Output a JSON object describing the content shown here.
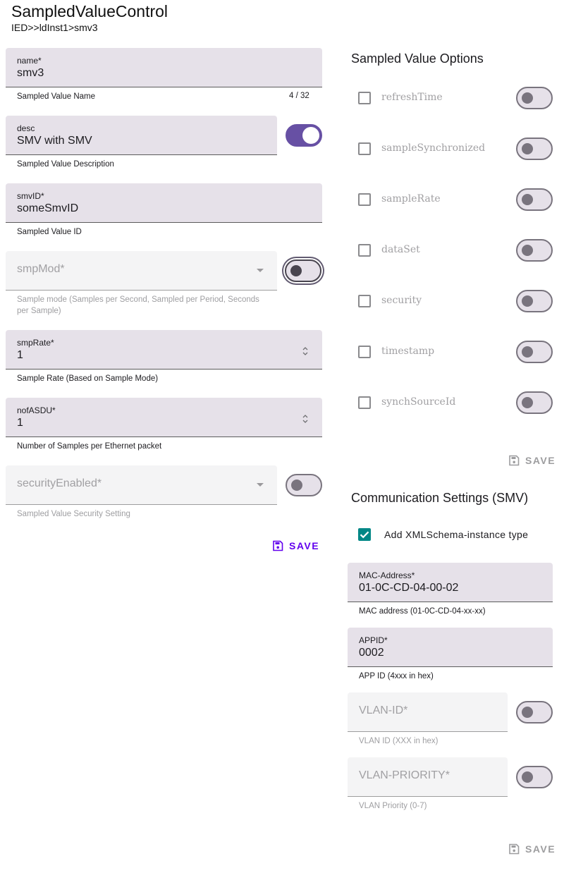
{
  "header": {
    "title": "SampledValueControl",
    "breadcrumb": "IED>>ldInst1>smv3"
  },
  "left_form": {
    "name": {
      "label": "name*",
      "value": "smv3",
      "helper": "Sampled Value Name",
      "counter": "4 / 32"
    },
    "desc": {
      "label": "desc",
      "value": "SMV with SMV",
      "helper": "Sampled Value Description",
      "switch_on": true
    },
    "smvID": {
      "label": "smvID*",
      "value": "someSmvID",
      "helper": "Sampled Value ID"
    },
    "smpMod": {
      "placeholder": "smpMod*",
      "helper": "Sample mode (Samples per Second, Sampled per Period, Seconds per Sample)",
      "switch_on": false
    },
    "smpRate": {
      "label": "smpRate*",
      "value": "1",
      "helper": "Sample Rate (Based on Sample Mode)"
    },
    "nofASDU": {
      "label": "nofASDU*",
      "value": "1",
      "helper": "Number of Samples per Ethernet packet"
    },
    "securityEnabled": {
      "placeholder": "securityEnabled*",
      "helper": "Sampled Value Security Setting",
      "switch_on": false
    },
    "save_label": "SAVE"
  },
  "options": {
    "title": "Sampled Value Options",
    "items": [
      {
        "label": "refreshTime",
        "checked": false,
        "switch_on": false
      },
      {
        "label": "sampleSynchronized",
        "checked": false,
        "switch_on": false
      },
      {
        "label": "sampleRate",
        "checked": false,
        "switch_on": false
      },
      {
        "label": "dataSet",
        "checked": false,
        "switch_on": false
      },
      {
        "label": "security",
        "checked": false,
        "switch_on": false
      },
      {
        "label": "timestamp",
        "checked": false,
        "switch_on": false
      },
      {
        "label": "synchSourceId",
        "checked": false,
        "switch_on": false
      }
    ],
    "save_label": "SAVE"
  },
  "comm": {
    "title": "Communication Settings (SMV)",
    "xmlschema": {
      "label": "Add XMLSchema-instance type",
      "checked": true
    },
    "mac": {
      "label": "MAC-Address*",
      "value": "01-0C-CD-04-00-02",
      "helper": "MAC address (01-0C-CD-04-xx-xx)"
    },
    "appid": {
      "label": "APPID*",
      "value": "0002",
      "helper": "APP ID (4xxx in hex)"
    },
    "vlan_id": {
      "placeholder": "VLAN-ID*",
      "helper": "VLAN ID (XXX in hex)",
      "switch_on": false
    },
    "vlan_priority": {
      "placeholder": "VLAN-PRIORITY*",
      "helper": "VLAN Priority (0-7)",
      "switch_on": false
    },
    "save_label": "SAVE"
  },
  "colors": {
    "primary": "#6750a4",
    "save_active": "#6200ee",
    "checkbox_checked": "#018786",
    "field_fill": "#e6e1e9"
  }
}
